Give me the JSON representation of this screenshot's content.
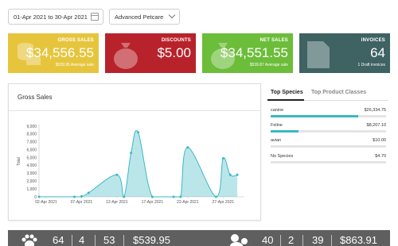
{
  "filters": {
    "date_range": "01-Apr 2021 to 30-Apr 2021",
    "store": "Advanced Petcare"
  },
  "cards": [
    {
      "title": "GROSS SALES",
      "value": "$34,556.55",
      "sub": "$539.95 Average sale",
      "color": "#e6c53d",
      "icon": "coins-icon"
    },
    {
      "title": "DISCOUNTS",
      "value": "$5.00",
      "sub": "",
      "color": "#b8222a",
      "icon": "money-bag-icon"
    },
    {
      "title": "NET SALES",
      "value": "$34,551.55",
      "sub": "$539.87 Average sale",
      "color": "#6cbd3a",
      "icon": "money-bag-icon"
    },
    {
      "title": "INVOICES",
      "value": "64",
      "sub": "1 Draft invoices",
      "color": "#3f6262",
      "icon": "document-icon"
    }
  ],
  "gross_sales": {
    "title": "Gross Sales"
  },
  "chart_data": {
    "type": "area",
    "title": "Gross Sales",
    "ylabel": "Total",
    "xlabel": "",
    "ylim": [
      0,
      9000
    ],
    "yticks": [
      0,
      1000,
      2000,
      3000,
      4000,
      5000,
      6000,
      7000,
      8000,
      9000
    ],
    "ytick_labels": [
      "0",
      "1,000",
      "2,000",
      "3,000",
      "4,000",
      "5,000",
      "6,000",
      "7,000",
      "8,000",
      "9,000"
    ],
    "xtick_labels": [
      "02-Apr 2021",
      "07-Apr 2021",
      "12-Apr 2021",
      "17-Apr 2021",
      "22-Apr 2021",
      "27-Apr 2021"
    ],
    "xtick_days": [
      2,
      7,
      12,
      17,
      22,
      27
    ],
    "x_range": [
      1,
      30
    ],
    "series": [
      {
        "color": "#3ab8c4",
        "x": [
          1,
          6,
          7,
          8,
          12,
          13,
          14,
          15,
          17,
          20,
          21,
          22,
          26,
          27,
          28,
          29
        ],
        "y": [
          0,
          0,
          50,
          500,
          2800,
          0,
          5600,
          8200,
          0,
          0,
          0,
          6300,
          0,
          4900,
          2800,
          2800
        ]
      }
    ],
    "grid": false
  },
  "species": {
    "tabs": [
      "Top Species",
      "Top Product Classes"
    ],
    "rows": [
      {
        "name": "canine",
        "amount": "$26,334.75",
        "fraction": 0.76
      },
      {
        "name": "Feline",
        "amount": "$8,207.10",
        "fraction": 0.24
      },
      {
        "name": "avian",
        "amount": "$10.00",
        "fraction": 0.0
      },
      {
        "name": "No Species",
        "amount": "$4.70",
        "fraction": 0.0
      }
    ]
  },
  "bottom_bar": {
    "left_values": [
      "64",
      "4",
      "53",
      "$539.95"
    ],
    "right_values": [
      "40",
      "2",
      "39",
      "$863.91"
    ]
  }
}
